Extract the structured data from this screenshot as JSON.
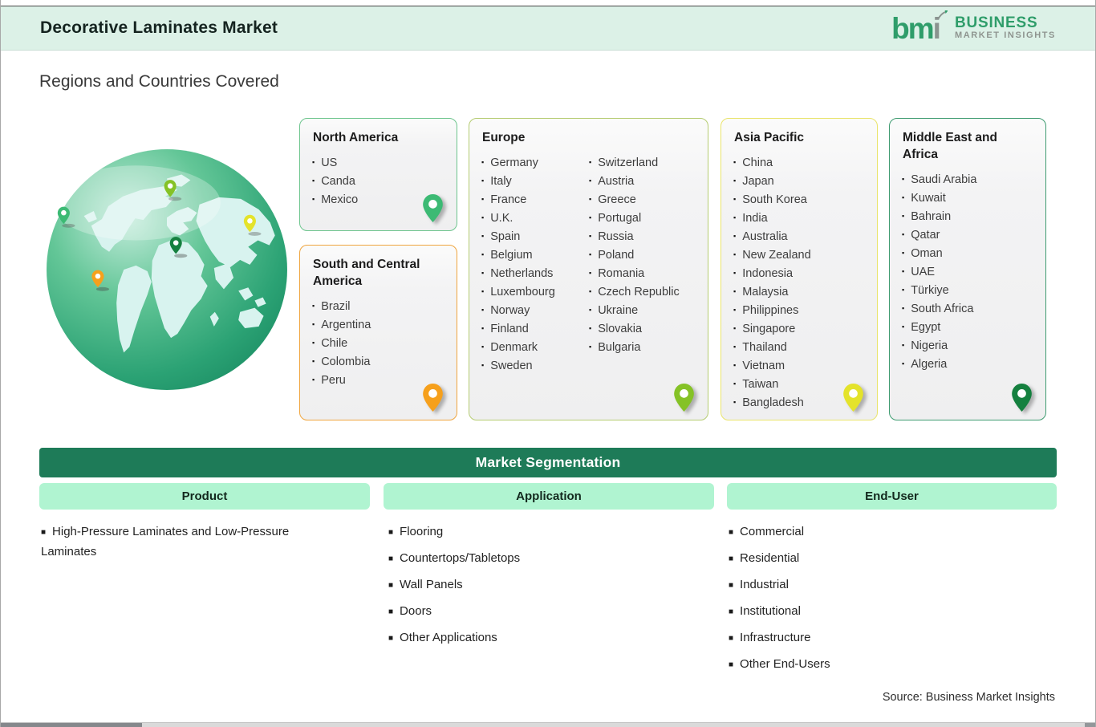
{
  "header": {
    "title": "Decorative Laminates Market",
    "logo": {
      "mark": "bm",
      "mark_i": "i",
      "line1": "BUSINESS",
      "line2": "MARKET INSIGHTS"
    }
  },
  "section_title": "Regions and Countries Covered",
  "regions": [
    {
      "key": "na",
      "name": "North America",
      "accent": "#6ec58e",
      "pin": "#3cba74",
      "columns": [
        [
          "US",
          "Canda",
          "Mexico"
        ]
      ]
    },
    {
      "key": "sca",
      "name": "South and Central America",
      "accent": "#efa53f",
      "pin": "#f6a01c",
      "columns": [
        [
          "Brazil",
          "Argentina",
          "Chile",
          "Colombia",
          "Peru"
        ]
      ]
    },
    {
      "key": "eu",
      "name": "Europe",
      "accent": "#b5cc72",
      "pin": "#85c226",
      "columns": [
        [
          "Germany",
          "Italy",
          "France",
          "U.K.",
          "Spain",
          "Belgium",
          "Netherlands",
          "Luxembourg",
          "Norway",
          "Finland",
          "Denmark",
          "Sweden"
        ],
        [
          "Switzerland",
          "Austria",
          "Greece",
          "Portugal",
          "Russia",
          "Poland",
          "Romania",
          "Czech Republic",
          "Ukraine",
          "Slovakia",
          "Bulgaria"
        ]
      ]
    },
    {
      "key": "ap",
      "name": "Asia Pacific",
      "accent": "#e9e46b",
      "pin": "#e4e32b",
      "columns": [
        [
          "China",
          "Japan",
          "South Korea",
          "India",
          "Australia",
          "New Zealand",
          "Indonesia",
          "Malaysia",
          "Philippines",
          "Singapore",
          "Thailand",
          "Vietnam",
          "Taiwan",
          "Bangladesh"
        ]
      ]
    },
    {
      "key": "mea",
      "name": "Middle East and Africa",
      "accent": "#3f9c71",
      "pin": "#15803f",
      "columns": [
        [
          "Saudi Arabia",
          "Kuwait",
          "Bahrain",
          "Qatar",
          "Oman",
          "UAE",
          "Türkiye",
          "South Africa",
          "Egypt",
          "Nigeria",
          "Algeria"
        ]
      ]
    }
  ],
  "segmentation": {
    "title": "Market Segmentation",
    "bar_color": "#1e7b58",
    "chip_color": "#b0f4d1",
    "columns": [
      {
        "header": "Product",
        "items": [
          "High-Pressure Laminates and Low-Pressure Laminates"
        ]
      },
      {
        "header": "Application",
        "items": [
          "Flooring",
          "Countertops/Tabletops",
          "Wall Panels",
          "Doors",
          "Other Applications"
        ]
      },
      {
        "header": "End-User",
        "items": [
          "Commercial",
          "Residential",
          "Industrial",
          "Institutional",
          "Infrastructure",
          "Other End-Users"
        ]
      }
    ]
  },
  "source": "Source: Business Market Insights"
}
